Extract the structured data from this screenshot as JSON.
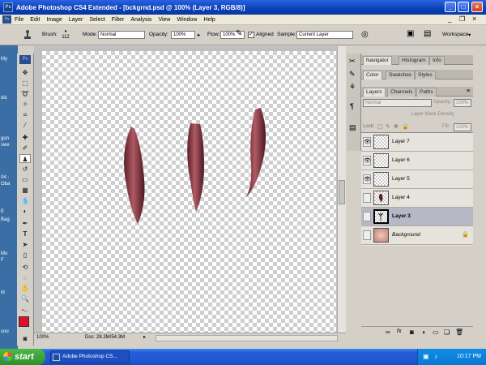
{
  "window": {
    "title": "Adobe Photoshop CS4 Extended - [bckgrnd.psd @ 100% (Layer 3, RGB/8)]",
    "minimize_glyph": "_",
    "maximize_glyph": "□",
    "close_glyph": "×",
    "doc_minimize_glyph": "_",
    "doc_restore_glyph": "❐",
    "doc_close_glyph": "×"
  },
  "menubar": {
    "logo": "Ps",
    "items": [
      "File",
      "Edit",
      "Image",
      "Layer",
      "Select",
      "Filter",
      "Analysis",
      "View",
      "Window",
      "Help"
    ]
  },
  "options": {
    "brush_label": "Brush:",
    "brush_size": "112",
    "mode_label": "Mode:",
    "mode_value": "Normal",
    "opacity_label": "Opacity:",
    "opacity_value": "100%",
    "flow_label": "Flow:",
    "flow_value": "100%",
    "aligned_label": "Aligned",
    "sample_label": "Sample:",
    "sample_value": "Current Layer",
    "workspace_label": "Workspace"
  },
  "left_strip": [
    "My",
    "dis",
    "gun",
    "swe",
    "04 -",
    "Oba",
    "E",
    "Bag",
    "Mo",
    "F",
    "id",
    "sou"
  ],
  "status": {
    "zoom": "100%",
    "doc": "Doc: 28.3M/54.3M"
  },
  "panels": {
    "navigator_tabs": [
      "Navigator",
      "Histogram",
      "Info"
    ],
    "color_tabs": [
      "Color",
      "Swatches",
      "Styles"
    ],
    "layers_tabs": [
      "Layers",
      "Channels",
      "Paths"
    ],
    "blend_mode": "Normal",
    "opacity_label": "Opacity:",
    "opacity_value": "100%",
    "mask_density_label": "Layer Mask Density",
    "lock_label": "Lock:",
    "fill_label": "Fill:",
    "fill_value": "100%",
    "layers": [
      {
        "name": "Layer 7",
        "visible": true
      },
      {
        "name": "Layer 6",
        "visible": true
      },
      {
        "name": "Layer 5",
        "visible": true
      },
      {
        "name": "Layer 4",
        "visible": false
      },
      {
        "name": "Layer 3",
        "visible": false,
        "selected": true
      },
      {
        "name": "Background",
        "visible": false
      }
    ],
    "footer_icons": [
      "link-icon",
      "fx-icon",
      "mask-icon",
      "adjustment-icon",
      "folder-icon",
      "new-layer-icon",
      "trash-icon"
    ]
  },
  "taskbar": {
    "start_label": "start",
    "task_label": "Adobe Photoshop CS...",
    "clock": "10:17 PM"
  },
  "colors": {
    "foreground": "#e0102c",
    "background": "#ffffff",
    "claw": "#8a3a44"
  }
}
